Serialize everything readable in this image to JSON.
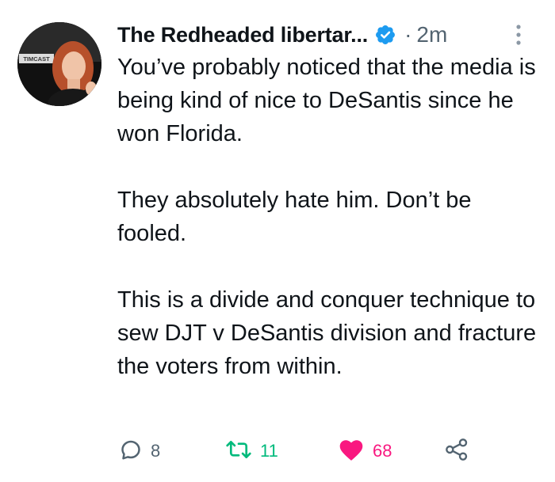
{
  "tweet": {
    "author_display_name": "The Redheaded libertar...",
    "separator": "·",
    "time_ago": "2m",
    "avatar_text": "TIMCAST",
    "paragraphs": [
      "You’ve probably noticed that the media is being kind of nice to DeSantis since he won Florida.",
      "They absolutely hate him. Don’t be fooled.",
      "This is a divide and conquer technique to sew DJT v DeSantis division and fracture the voters from within."
    ]
  },
  "actions": {
    "replies": "8",
    "retweets": "11",
    "likes": "68"
  },
  "colors": {
    "verified": "#1d9bf0",
    "retweet": "#00ba7c",
    "like": "#f91880",
    "muted": "#536471"
  },
  "icons": {
    "verified": "verified-badge-icon",
    "more": "more-vertical-icon",
    "reply": "reply-bubble-icon",
    "retweet": "retweet-icon",
    "like": "heart-icon",
    "share": "share-icon"
  }
}
